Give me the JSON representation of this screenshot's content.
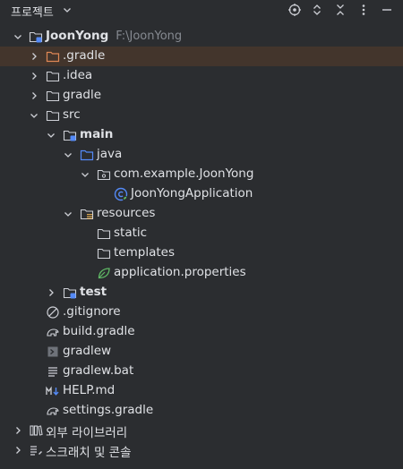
{
  "header": {
    "title": "프로젝트",
    "icons": [
      "locate-icon",
      "expand-collapse-icon",
      "collapse-all-icon",
      "more-options-icon",
      "minimize-icon"
    ]
  },
  "tree": {
    "root": {
      "label": "JoonYong",
      "path": "F:\\JoonYong"
    },
    "gradle_hidden": ".gradle",
    "idea": ".idea",
    "gradle": "gradle",
    "src": "src",
    "main": "main",
    "java": "java",
    "package": "com.example.JoonYong",
    "app_class": "JoonYongApplication",
    "resources": "resources",
    "static": "static",
    "templates": "templates",
    "app_props": "application.properties",
    "test": "test",
    "gitignore": ".gitignore",
    "build_gradle": "build.gradle",
    "gradlew": "gradlew",
    "gradlew_bat": "gradlew.bat",
    "help_md": "HELP.md",
    "settings_gradle": "settings.gradle",
    "external_libs": "외부 라이브러리",
    "scratches": "스크래치 및 콘솔"
  },
  "colors": {
    "background": "#2b2d30",
    "selected_row": "#43352c",
    "text": "#dfe1e5",
    "hint": "#868a91",
    "folder_orange": "#e08855",
    "accent_blue": "#548af7"
  }
}
